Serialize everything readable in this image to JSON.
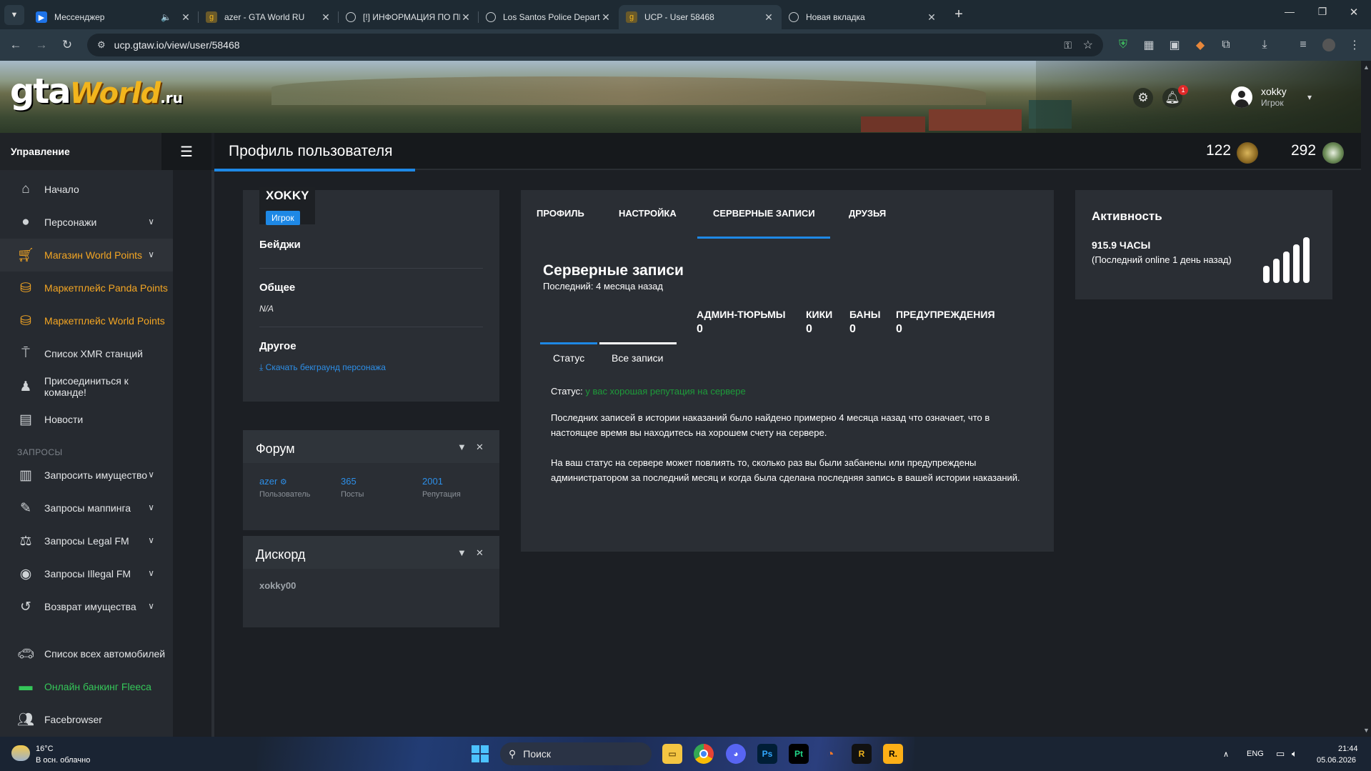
{
  "browser": {
    "tabs": [
      {
        "title": "Мессенджер",
        "icon": "messenger-icon",
        "active": false
      },
      {
        "title": "azer - GTA World RU",
        "icon": "gtaw-icon",
        "active": false
      },
      {
        "title": "[!] ИНФОРМАЦИЯ ПО ПРОГРА",
        "icon": "globe-icon",
        "active": false
      },
      {
        "title": "Los Santos Police Department -",
        "icon": "globe-icon",
        "active": false
      },
      {
        "title": "UCP - User 58468",
        "icon": "gtaw-icon",
        "active": true
      },
      {
        "title": "Новая вкладка",
        "icon": "chrome-icon",
        "active": false
      }
    ],
    "url": "ucp.gtaw.io/view/user/58468"
  },
  "header": {
    "logo": {
      "gta": "gta",
      "world": "World",
      "ru": ".ru"
    },
    "notification_count": "1",
    "user_name": "xokky",
    "user_role": "Игрок"
  },
  "sidebar": {
    "title": "Управление",
    "items": [
      {
        "label": "Начало",
        "icon": "home-icon"
      },
      {
        "label": "Персонажи",
        "icon": "user-icon"
      },
      {
        "label": "Магазин World Points",
        "icon": "cart-icon"
      },
      {
        "label": "Маркетплейс Panda Points",
        "icon": "coins-icon"
      },
      {
        "label": "Маркетплейс World Points",
        "icon": "coins-icon"
      },
      {
        "label": "Список XMR станций",
        "icon": "antenna-icon"
      },
      {
        "label": "Присоединиться к команде!",
        "icon": "user-tie-icon"
      },
      {
        "label": "Новости",
        "icon": "newspaper-icon"
      }
    ],
    "section": "ЗАПРОСЫ",
    "requests": [
      {
        "label": "Запросить имущество",
        "icon": "building-icon"
      },
      {
        "label": "Запросы маппинга",
        "icon": "brush-icon"
      },
      {
        "label": "Запросы Legal FM",
        "icon": "scales-icon"
      },
      {
        "label": "Запросы Illegal FM",
        "icon": "mask-icon"
      },
      {
        "label": "Возврат имущества",
        "icon": "undo-icon"
      }
    ],
    "bottom": [
      {
        "label": "Список всех автомобилей",
        "icon": "car-icon"
      },
      {
        "label": "Онлайн банкинг Fleeca",
        "icon": "money-icon"
      },
      {
        "label": "Facebrowser",
        "icon": "users-icon"
      }
    ]
  },
  "main": {
    "page_title": "Профиль пользователя",
    "currency1": "122",
    "currency2": "292"
  },
  "profile": {
    "name": "XOKKY",
    "role": "Игрок",
    "badges_label": "Бейджи",
    "general_label": "Общее",
    "general_value": "N/A",
    "other_label": "Другое",
    "download_link": "Скачать бекграунд персонажа"
  },
  "forum": {
    "title": "Форум",
    "username": "azer",
    "username_label": "Пользователь",
    "posts": "365",
    "posts_label": "Посты",
    "reputation": "2001",
    "reputation_label": "Репутация"
  },
  "discord": {
    "title": "Дискорд",
    "value": "xokky00"
  },
  "records": {
    "tabs": [
      "ПРОФИЛЬ",
      "НАСТРОЙКА",
      "СЕРВЕРНЫЕ ЗАПИСИ",
      "ДРУЗЬЯ"
    ],
    "title": "Серверные записи",
    "last": "Последний: 4 месяца назад",
    "stats": [
      {
        "label": "АДМИН-ТЮРЬМЫ",
        "value": "0"
      },
      {
        "label": "КИКИ",
        "value": "0"
      },
      {
        "label": "БАНЫ",
        "value": "0"
      },
      {
        "label": "ПРЕДУПРЕЖДЕНИЯ",
        "value": "0"
      }
    ],
    "subtabs": [
      "Статус",
      "Все записи"
    ],
    "status_label": "Статус:",
    "status_value": "у вас хорошая репутация на сервере",
    "para1": "Последних записей в истории наказаний было найдено примерно 4 месяца назад что означает, что в настоящее время вы находитесь на хорошем счету на сервере.",
    "para2": "На ваш статус на сервере может повлиять то, сколько раз вы были забанены или предупреждены администратором за последний месяц и когда была сделана последняя запись в вашей истории наказаний."
  },
  "activity": {
    "title": "Активность",
    "hours": "915.9 ЧАСЫ",
    "last_online": "(Последний online 1 день назад)"
  },
  "taskbar": {
    "weather_temp": "16°C",
    "weather_desc": "В осн. облачно",
    "search": "Поиск",
    "lang": "ENG",
    "time": "21:44",
    "date": "05.06.2026"
  },
  "colors": {
    "accent": "#1e88e5",
    "orange": "#f4a623",
    "green": "#35c759",
    "status_green": "#1e9b3a"
  }
}
